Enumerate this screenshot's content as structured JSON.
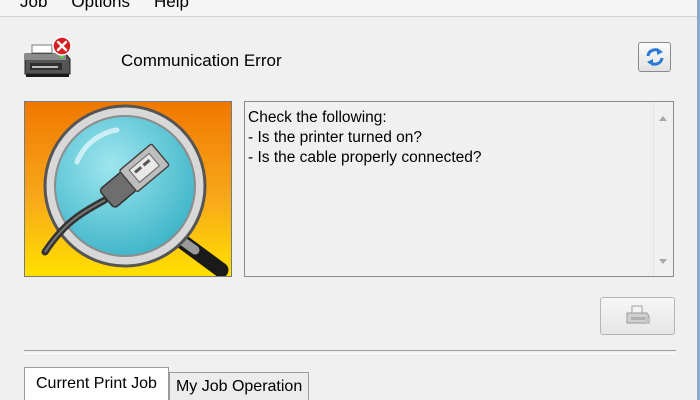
{
  "menu": {
    "items": [
      {
        "label": "Job"
      },
      {
        "label": "Options"
      },
      {
        "label": "Help"
      }
    ]
  },
  "status": {
    "title": "Communication Error",
    "printer_icon": "printer-error-icon",
    "refresh_icon": "refresh-icon"
  },
  "picture": {
    "icon": "magnifier-usb-cable-icon"
  },
  "message": {
    "text": "Check the following:\n- Is the printer turned on?\n- Is the cable properly connected?"
  },
  "print_button": {
    "icon": "printer-icon"
  },
  "tabs": [
    {
      "label": "Current Print Job",
      "active": true
    },
    {
      "label": "My Job Operation",
      "active": false
    }
  ],
  "colors": {
    "error_red": "#d42020",
    "refresh_blue": "#2a7bd4",
    "picture_orange": "#f28a10",
    "picture_yellow": "#ffd800",
    "lens_cyan": "#58c8d8"
  }
}
